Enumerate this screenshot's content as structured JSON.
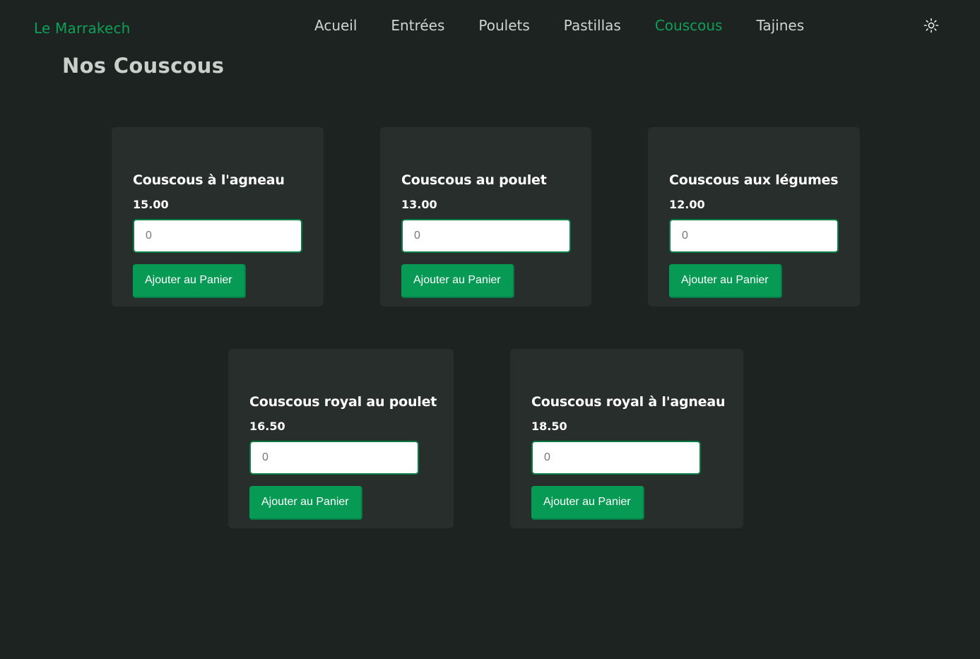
{
  "brand": "Le Marrakech",
  "nav": {
    "items": [
      {
        "label": "Acueil",
        "active": false
      },
      {
        "label": "Entrées",
        "active": false
      },
      {
        "label": "Poulets",
        "active": false
      },
      {
        "label": "Pastillas",
        "active": false
      },
      {
        "label": "Couscous",
        "active": true
      },
      {
        "label": "Tajines",
        "active": false
      }
    ],
    "theme_toggle_icon": "sun-icon"
  },
  "page_title": "Nos Couscous",
  "products": [
    {
      "name": "Couscous à l'agneau",
      "price": "15.00",
      "qty_placeholder": "0",
      "button": "Ajouter au Panier"
    },
    {
      "name": "Couscous au poulet",
      "price": "13.00",
      "qty_placeholder": "0",
      "button": "Ajouter au Panier"
    },
    {
      "name": "Couscous aux légumes",
      "price": "12.00",
      "qty_placeholder": "0",
      "button": "Ajouter au Panier"
    },
    {
      "name": "Couscous royal au poulet",
      "price": "16.50",
      "qty_placeholder": "0",
      "button": "Ajouter au Panier"
    },
    {
      "name": "Couscous royal à l'agneau",
      "price": "18.50",
      "qty_placeholder": "0",
      "button": "Ajouter au Panier"
    }
  ],
  "colors": {
    "background": "#1d2320",
    "card": "#272e2c",
    "accent": "#079a55",
    "brand": "#0fa058"
  }
}
